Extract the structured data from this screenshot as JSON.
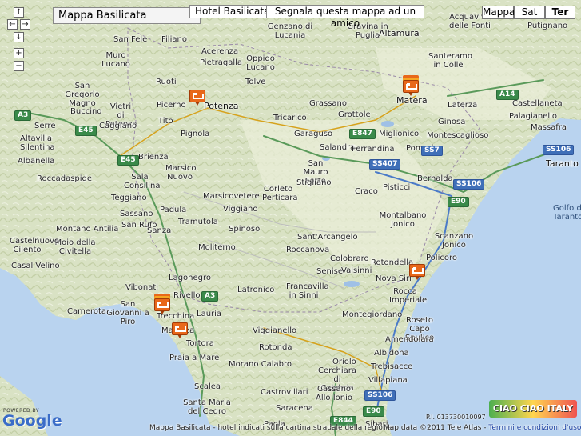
{
  "map_title": "Mappa Basilicata",
  "links": {
    "hotels": "Hotel Basilicata",
    "report": "Segnala questa mappa ad un amico"
  },
  "map_types": [
    "Mappa",
    "Sat",
    "Ter"
  ],
  "active_map_type": "Ter",
  "nav_icons": [
    "arrow-up-icon",
    "arrow-left-icon",
    "arrow-right-icon",
    "arrow-down-icon",
    "zoom-in-icon",
    "zoom-out-icon"
  ],
  "zoom_symbols": {
    "plus": "+",
    "minus": "−"
  },
  "towns": [
    {
      "name": "San Fele",
      "big": false
    },
    {
      "name": "Filiano",
      "big": false
    },
    {
      "name": "Acerenza",
      "big": false
    },
    {
      "name": "Genzano di Lucania",
      "big": false
    },
    {
      "name": "Gravina in Puglia",
      "big": false
    },
    {
      "name": "Altamura",
      "big": false
    },
    {
      "name": "Acquaviva delle Fonti",
      "big": false
    },
    {
      "name": "Putignano",
      "big": false
    },
    {
      "name": "Muro Lucano",
      "big": false
    },
    {
      "name": "Pietragalla",
      "big": false
    },
    {
      "name": "Oppido Lucano",
      "big": false
    },
    {
      "name": "Santeramo in Colle",
      "big": false
    },
    {
      "name": "San Gregorio Magno",
      "big": false
    },
    {
      "name": "Ruoti",
      "big": false
    },
    {
      "name": "Tolve",
      "big": false
    },
    {
      "name": "Potenza",
      "big": true
    },
    {
      "name": "Picerno",
      "big": false
    },
    {
      "name": "Grassano",
      "big": false
    },
    {
      "name": "Matera",
      "big": true
    },
    {
      "name": "Laterza",
      "big": false
    },
    {
      "name": "Castellaneta",
      "big": false
    },
    {
      "name": "Buccino",
      "big": false
    },
    {
      "name": "Vietri di Potenza",
      "big": false
    },
    {
      "name": "Tito",
      "big": false
    },
    {
      "name": "Tricarico",
      "big": false
    },
    {
      "name": "Grottole",
      "big": false
    },
    {
      "name": "Ginosa",
      "big": false
    },
    {
      "name": "Palagianello",
      "big": false
    },
    {
      "name": "Serre",
      "big": false
    },
    {
      "name": "Caggiano",
      "big": false
    },
    {
      "name": "Pignola",
      "big": false
    },
    {
      "name": "Garaguso",
      "big": false
    },
    {
      "name": "Miglionico",
      "big": false
    },
    {
      "name": "Montescaglioso",
      "big": false
    },
    {
      "name": "Massafra",
      "big": false
    },
    {
      "name": "Altavilla Silentina",
      "big": false
    },
    {
      "name": "Salandra",
      "big": false
    },
    {
      "name": "Ferrandina",
      "big": false
    },
    {
      "name": "Pomarico",
      "big": false
    },
    {
      "name": "Taranto",
      "big": true
    },
    {
      "name": "Albanella",
      "big": false
    },
    {
      "name": "Brienza",
      "big": false
    },
    {
      "name": "San Mauro Forte",
      "big": false
    },
    {
      "name": "Bernalda",
      "big": false
    },
    {
      "name": "Roccadaspide",
      "big": false
    },
    {
      "name": "Sala Consilina",
      "big": false
    },
    {
      "name": "Marsico Nuovo",
      "big": false
    },
    {
      "name": "Stigliano",
      "big": false
    },
    {
      "name": "Pisticci",
      "big": false
    },
    {
      "name": "Golfo di Taranto",
      "big": false
    },
    {
      "name": "Corleto Perticara",
      "big": false
    },
    {
      "name": "Craco",
      "big": false
    },
    {
      "name": "Teggiano",
      "big": false
    },
    {
      "name": "Marsicovetere",
      "big": false
    },
    {
      "name": "Sassano",
      "big": false
    },
    {
      "name": "Padula",
      "big": false
    },
    {
      "name": "Viggiano",
      "big": false
    },
    {
      "name": "Montalbano Jonico",
      "big": false
    },
    {
      "name": "San Rufo",
      "big": false
    },
    {
      "name": "Tramutola",
      "big": false
    },
    {
      "name": "Montano Antilia",
      "big": false
    },
    {
      "name": "Sanza",
      "big": false
    },
    {
      "name": "Spinoso",
      "big": false
    },
    {
      "name": "Scanzano Jonico",
      "big": false
    },
    {
      "name": "Moio della Civitella",
      "big": false
    },
    {
      "name": "Sant'Arcangelo",
      "big": false
    },
    {
      "name": "Policoro",
      "big": false
    },
    {
      "name": "Castelnuovo Cilento",
      "big": false
    },
    {
      "name": "Moliterno",
      "big": false
    },
    {
      "name": "Roccanova",
      "big": false
    },
    {
      "name": "Casal Velino",
      "big": false
    },
    {
      "name": "Colobraro",
      "big": false
    },
    {
      "name": "Rotondella",
      "big": false
    },
    {
      "name": "Senise",
      "big": false
    },
    {
      "name": "Valsinni",
      "big": false
    },
    {
      "name": "Nova Siri",
      "big": false
    },
    {
      "name": "Lagonegro",
      "big": false
    },
    {
      "name": "Vibonati",
      "big": false
    },
    {
      "name": "Latronico",
      "big": false
    },
    {
      "name": "Francavilla in Sinni",
      "big": false
    },
    {
      "name": "Rivello",
      "big": false
    },
    {
      "name": "Rocca Imperiale",
      "big": false
    },
    {
      "name": "Camerota",
      "big": false
    },
    {
      "name": "San Giovanni a Piro",
      "big": false
    },
    {
      "name": "Trecchina",
      "big": false
    },
    {
      "name": "Lauria",
      "big": false
    },
    {
      "name": "Montegiordano",
      "big": false
    },
    {
      "name": "Maratea",
      "big": false
    },
    {
      "name": "Viggianello",
      "big": false
    },
    {
      "name": "Roseto Capo Spulico",
      "big": false
    },
    {
      "name": "Tortora",
      "big": false
    },
    {
      "name": "Rotonda",
      "big": false
    },
    {
      "name": "Amendolara",
      "big": false
    },
    {
      "name": "Albidona",
      "big": false
    },
    {
      "name": "Praia a Mare",
      "big": false
    },
    {
      "name": "Morano Calabro",
      "big": false
    },
    {
      "name": "Trebisacce",
      "big": false
    },
    {
      "name": "Oriolo",
      "big": false
    },
    {
      "name": "Cerchiara di Calabria",
      "big": false
    },
    {
      "name": "Villapiana",
      "big": false
    },
    {
      "name": "Scalea",
      "big": false
    },
    {
      "name": "Castrovillari",
      "big": false
    },
    {
      "name": "Cassano Allo Ionio",
      "big": false
    },
    {
      "name": "Santa Maria del Cedro",
      "big": false
    },
    {
      "name": "Saracena",
      "big": false
    },
    {
      "name": "Paola",
      "big": false
    },
    {
      "name": "Sibari",
      "big": false
    }
  ],
  "roads": [
    {
      "name": "A3",
      "type": "green"
    },
    {
      "name": "A14",
      "type": "green"
    },
    {
      "name": "E45",
      "type": "green"
    },
    {
      "name": "E45",
      "type": "green"
    },
    {
      "name": "E847",
      "type": "green"
    },
    {
      "name": "SS407",
      "type": "blue"
    },
    {
      "name": "SS7",
      "type": "blue"
    },
    {
      "name": "SS106",
      "type": "blue"
    },
    {
      "name": "SS106",
      "type": "blue"
    },
    {
      "name": "E90",
      "type": "green"
    },
    {
      "name": "E844",
      "type": "green"
    },
    {
      "name": "E90",
      "type": "green"
    },
    {
      "name": "SS106",
      "type": "blue"
    },
    {
      "name": "A3",
      "type": "green"
    }
  ],
  "hotels": [
    {
      "name": "hotel-potenza",
      "stack": false
    },
    {
      "name": "hotel-matera",
      "stack": true
    },
    {
      "name": "hotel-policoro",
      "stack": false
    },
    {
      "name": "hotel-maratea-north",
      "stack": true
    },
    {
      "name": "hotel-maratea",
      "stack": false
    }
  ],
  "powered_by": "POWERED BY",
  "google_logo": "Google",
  "pi": "P.I. 013730010097",
  "ciao_logo": "CIAO CIAO ITALY",
  "footer": {
    "caption": "Mappa Basilicata - hotel indicati sulla cartina stradale della regione",
    "map_data": "Map data ©2011 Tele Atlas - ",
    "terms": "Termini e condizioni d'uso"
  },
  "colors": {
    "sea": "#b9d3ef",
    "land": "#dfe6cf",
    "hotel": "#e8681a",
    "road_green": "#3a8a4a",
    "road_blue": "#3f6fb8"
  }
}
